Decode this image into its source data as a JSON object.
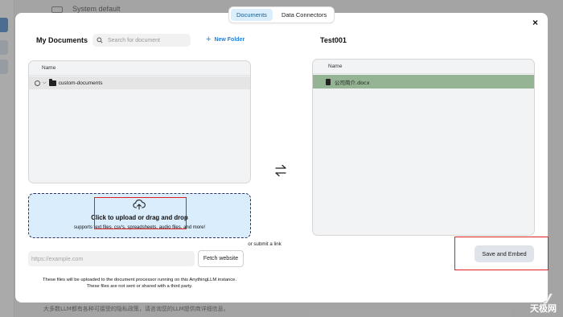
{
  "background": {
    "top_text": "System default",
    "bottom_text": "大多数LLM都有各种可接受的隐私政策，请咨询您的LLM提供商详细信息。"
  },
  "watermark": {
    "line1": "ey",
    "line2": "天极网"
  },
  "modal": {
    "tabs": [
      {
        "label": "Documents",
        "active": true
      },
      {
        "label": "Data Connectors",
        "active": false
      }
    ],
    "close_icon": "×"
  },
  "my_documents": {
    "title": "My Documents",
    "search_placeholder": "Search for document",
    "new_folder_label": "New Folder",
    "column_header": "Name",
    "folders": [
      {
        "name": "custom-documents"
      }
    ]
  },
  "upload": {
    "main_text": "Click to upload or drag and drop",
    "sub_text": "supports text files, csv's, spreadsheets, audio files, and more!",
    "or_link_text": "or submit a link",
    "url_placeholder": "https://example.com",
    "fetch_button": "Fetch website",
    "note_line1": "These files will be uploaded to the document processor running on this AnythingLLM instance.",
    "note_line2": "These files are not sent or shared with a third party."
  },
  "workspace": {
    "title": "Test001",
    "column_header": "Name",
    "files": [
      {
        "name": "公司简介.docx"
      }
    ],
    "save_button": "Save and Embed"
  },
  "colors": {
    "tab_active_bg": "#dbeefc",
    "dropzone_bg": "#d9edfd",
    "selected_file_bg": "#94b493",
    "accent_link": "#2a7fd0",
    "highlight_box": "#e02020"
  }
}
